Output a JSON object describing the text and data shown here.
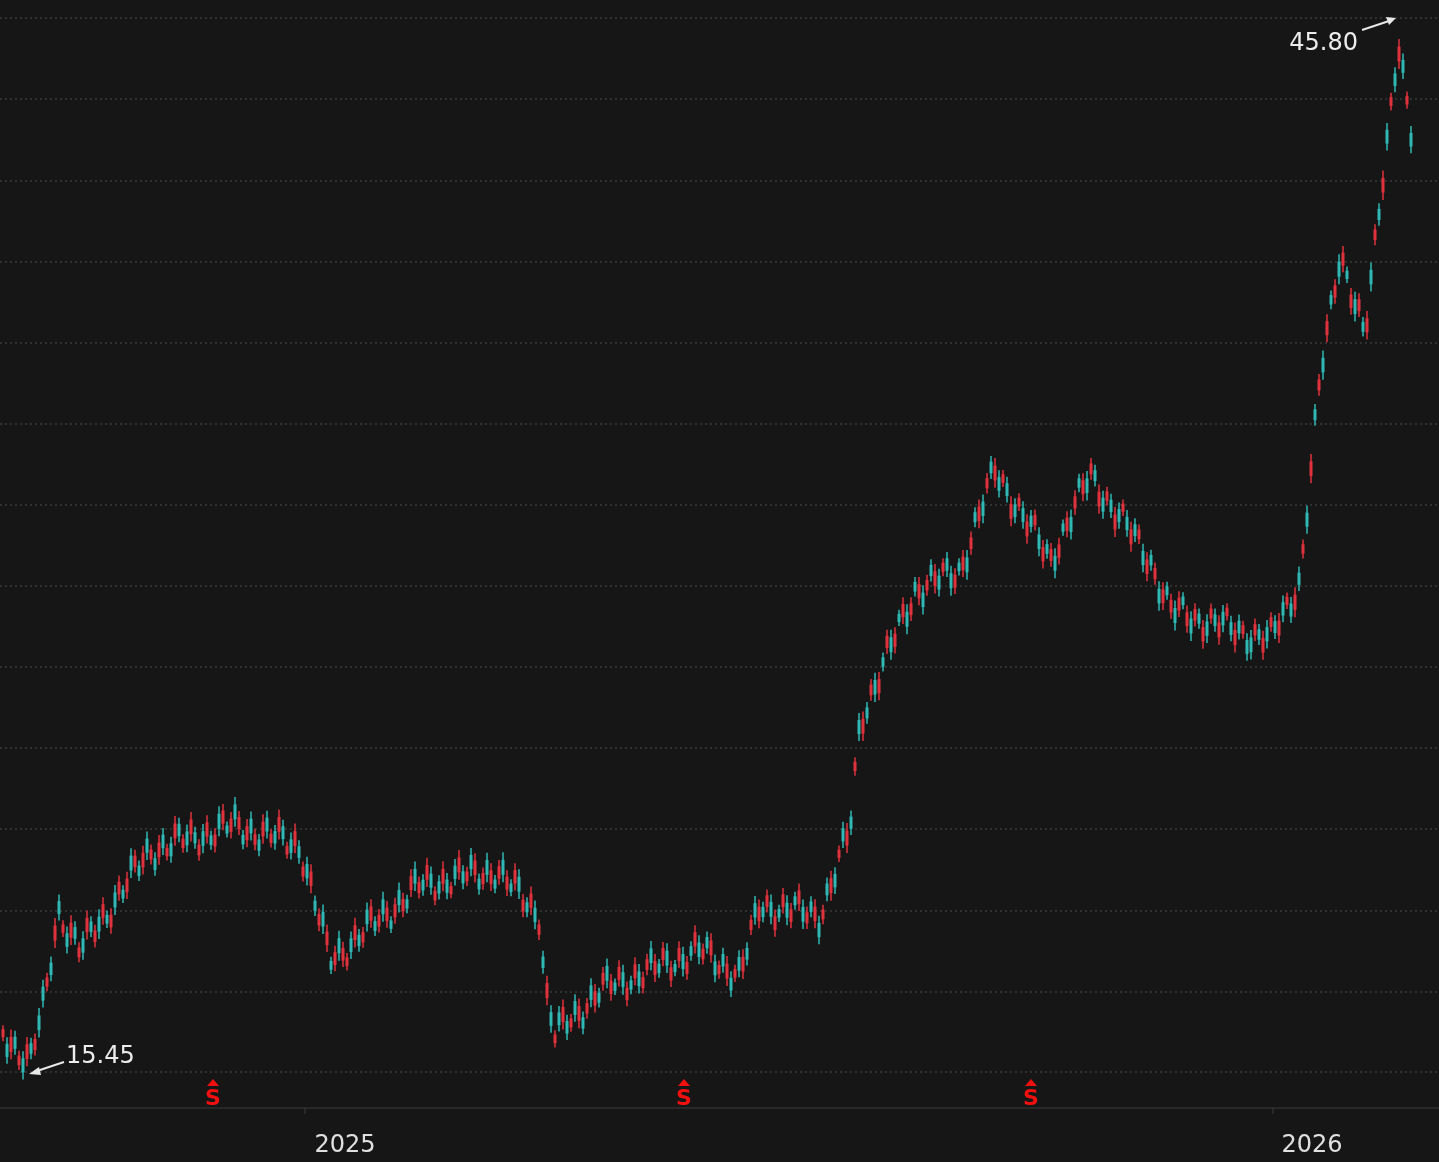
{
  "chart": {
    "high_label": "45.80",
    "low_label": "15.45",
    "markers": [
      "S",
      "S",
      "S"
    ],
    "x_labels": [
      "2025",
      "2026"
    ]
  }
}
